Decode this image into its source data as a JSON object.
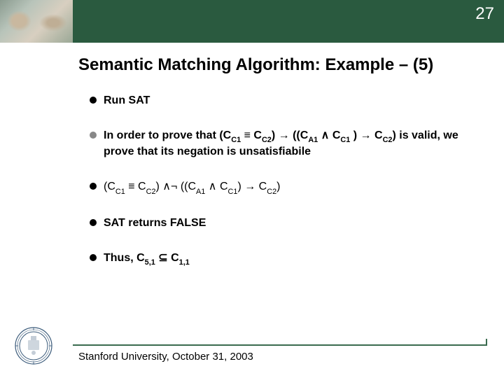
{
  "header": {
    "page_number": "27"
  },
  "title": "Semantic Matching Algorithm: Example – (5)",
  "bullets": {
    "b1": "Run SAT",
    "b2_prefix": "In order to prove that ",
    "b2_suffix": " is valid, we prove that its negation is unsatisfiabile",
    "b4": "SAT returns FALSE",
    "b5_prefix": "Thus, ",
    "formula": {
      "C": "C",
      "A1": "A1",
      "C1": "C1",
      "C2": "C2",
      "five_one": "5,1",
      "one_one": "1,1",
      "equiv": "≡",
      "and": "∧",
      "impl": "→",
      "notc": "¬",
      "sub": "⊆",
      "lp": "(",
      "rp": ")",
      "llp": "((",
      "space": " "
    }
  },
  "footer": {
    "text": "Stanford University, October 31, 2003"
  }
}
